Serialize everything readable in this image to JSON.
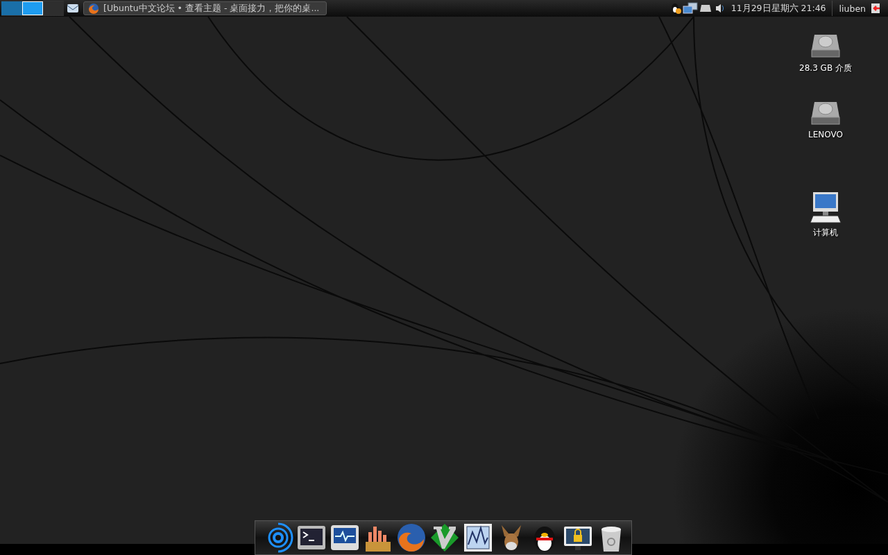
{
  "top_panel": {
    "workspaces": [
      {
        "selected": false
      },
      {
        "selected": true
      },
      {
        "selected": false
      }
    ],
    "tasks": [
      {
        "title": "[Ubuntu中文论坛 • 查看主题 - 桌面接力，把你的桌...",
        "selected": false
      }
    ],
    "clock": "11月29日星期六 21:46",
    "user": "liuben"
  },
  "desktop_icons": [
    {
      "kind": "drive",
      "label": "28.3 GB 介质"
    },
    {
      "kind": "drive",
      "label": "LENOVO"
    },
    {
      "kind": "computer",
      "label": "计算机"
    }
  ],
  "dock": {
    "items": [
      {
        "kind": "rings"
      },
      {
        "kind": "terminal"
      },
      {
        "kind": "monitor"
      },
      {
        "kind": "bars"
      },
      {
        "kind": "browser"
      },
      {
        "kind": "vim"
      },
      {
        "kind": "graph"
      },
      {
        "kind": "donkey"
      },
      {
        "kind": "penguin"
      },
      {
        "kind": "lock"
      },
      {
        "kind": "trash"
      }
    ]
  }
}
